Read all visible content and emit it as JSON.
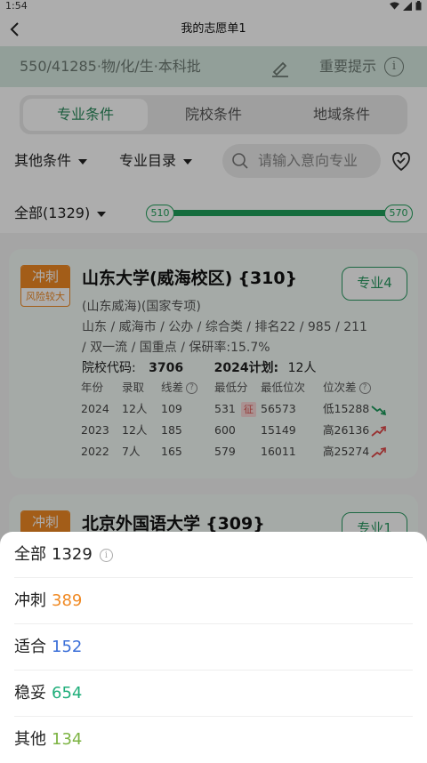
{
  "status_bar": {
    "time": "1:54"
  },
  "header": {
    "title": "我的志愿单1"
  },
  "score_bar": {
    "summary": "550/41285·物/化/生·本科批",
    "tips_label": "重要提示"
  },
  "tabs": [
    {
      "label": "专业条件",
      "active": true
    },
    {
      "label": "院校条件",
      "active": false
    },
    {
      "label": "地域条件",
      "active": false
    }
  ],
  "filters": {
    "other_label": "其他条件",
    "catalog_label": "专业目录",
    "search_placeholder": "请输入意向专业"
  },
  "range": {
    "all_label": "全部(1329)",
    "min": "510",
    "max": "570"
  },
  "cards": [
    {
      "badge_top": "冲刺",
      "badge_bottom": "风险较大",
      "name": "山东大学(威海校区)",
      "code_tag": "{310}",
      "majors_button": "专业4",
      "sub_name": "(山东威海)(国家专项)",
      "info_line1": "山东 / 威海市 / 公办 / 综合类 / 排名22 / 985 / 211",
      "info_line2": "/ 双一流 / 国重点 / 保研率:15.7%",
      "code_label": "院校代码:",
      "code_value": "3706",
      "plan_label": "2024计划:",
      "plan_value": "12人",
      "table_headers": [
        "年份",
        "录取",
        "线差",
        "最低分",
        "最低位次",
        "位次差"
      ],
      "rows": [
        {
          "year": "2024",
          "admit": "12人",
          "diff": "109",
          "min_score": "531",
          "tag": "征",
          "min_rank": "56573",
          "rank_diff": "低15288",
          "trend": "down"
        },
        {
          "year": "2023",
          "admit": "12人",
          "diff": "185",
          "min_score": "600",
          "tag": "",
          "min_rank": "15149",
          "rank_diff": "高26136",
          "trend": "up"
        },
        {
          "year": "2022",
          "admit": "7人",
          "diff": "165",
          "min_score": "579",
          "tag": "",
          "min_rank": "16011",
          "rank_diff": "高25274",
          "trend": "up"
        }
      ]
    },
    {
      "badge_top": "冲刺",
      "name": "北京外国语大学",
      "code_tag": "{309}",
      "majors_button": "专业1"
    }
  ],
  "sheet_options": [
    {
      "label": "全部",
      "count": "1329",
      "color": "#222222",
      "info": true
    },
    {
      "label": "冲刺",
      "count": "389",
      "color": "#f08a24",
      "info": false
    },
    {
      "label": "适合",
      "count": "152",
      "color": "#3b6fd8",
      "info": false
    },
    {
      "label": "稳妥",
      "count": "654",
      "color": "#1fae7a",
      "info": false
    },
    {
      "label": "其他",
      "count": "134",
      "color": "#7cb342",
      "info": false
    }
  ],
  "colors": {
    "accent_green": "#2a9a62",
    "risk_orange": "#f08a24",
    "score_bar_bg": "#d7ebe2"
  }
}
